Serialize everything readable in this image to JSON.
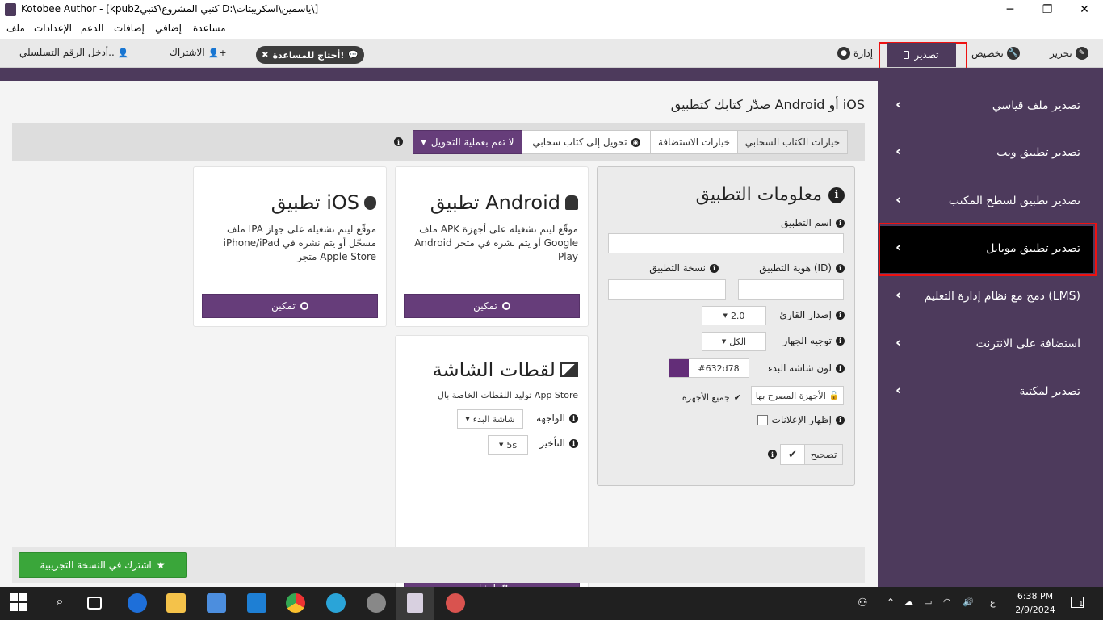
{
  "window": {
    "title": "Kotobee Author - [kpub2كتبي المشروع\\كتبي D:\\ياسمين\\اسكريبتات\\]",
    "minimize": "─",
    "maximize": "❐",
    "close": "✕"
  },
  "menu": [
    "ملف",
    "الإعدادات",
    "الدعم",
    "إضافات",
    "إضافي",
    "مساعدة"
  ],
  "topbar": {
    "edit": "تحرير",
    "customize": "تخصيص",
    "export": "تصدير",
    "manage": "إدارة",
    "help": "أحتاج للمساعدة!",
    "subscribe": "الاشتراك",
    "serial": "أدخل الرقم التسلسلي.."
  },
  "sidebar": {
    "items": [
      {
        "label": "تصدير ملف قياسي"
      },
      {
        "label": "تصدير تطبيق ويب"
      },
      {
        "label": "تصدير تطبيق لسطح المكتب"
      },
      {
        "label": "تصدير تطبيق موبايل"
      },
      {
        "label": "دمج مع نظام إدارة التعليم (LMS)"
      },
      {
        "label": "استضافة على الانترنت"
      },
      {
        "label": "تصدير لمكتبة"
      }
    ],
    "active_index": 3
  },
  "content": {
    "title": "صدّر كتابك كتطبيق Android أو iOS",
    "tabs": {
      "cloud_options": "خيارات الكتاب السحابي",
      "hosting_options": "خيارات الاستضافة",
      "convert_cloud": "تحويل إلى كتاب سحابي",
      "no_convert": "لا تقم بعملية التحويل"
    }
  },
  "appinfo": {
    "title": "معلومات التطبيق",
    "app_name_label": "اسم التطبيق",
    "app_id_label": "هوية التطبيق (ID)",
    "app_version_label": "نسخة التطبيق",
    "reader_version_label": "إصدار القارئ",
    "reader_version_value": "2.0",
    "orientation_label": "توجيه الجهاز",
    "orientation_value": "الكل",
    "splash_color_label": "لون شاشة البدء",
    "splash_color_value": "#632d78",
    "allowed_devices": "الأجهزة المصرح بها",
    "all_devices": "جميع الأجهزة",
    "show_ads": "إظهار الإعلانات",
    "debug": "تصحيح"
  },
  "android": {
    "title": "تطبيق Android",
    "desc": "ملف APK موقّع ليتم تشغيله على أجهزة Android أو يتم نشره في متجر Google Play",
    "enable": "تمكين"
  },
  "ios": {
    "title": "تطبيق iOS",
    "desc": "ملف IPA موقّع ليتم تشغيله على جهاز iPhone/iPad مسجّل أو يتم نشره في متجر Apple Store",
    "enable": "تمكين"
  },
  "screenshots": {
    "title": "لقطات الشاشة",
    "desc": "توليد اللقطات الخاصة بال App Store",
    "face_label": "الواجهة",
    "face_value": "شاشة البدء",
    "delay_label": "التأخير",
    "delay_value": "5s",
    "create": "إنشاء"
  },
  "trial": {
    "label": "اشترك في النسخة التجريبية"
  },
  "taskbar": {
    "time": "6:38 PM",
    "date": "2/9/2024",
    "lang": "ع",
    "notif_count": "1"
  },
  "colors": {
    "brand": "#4d3a5c",
    "button": "#663d7a",
    "trial": "#3aa63a",
    "splash": "#632d78"
  }
}
